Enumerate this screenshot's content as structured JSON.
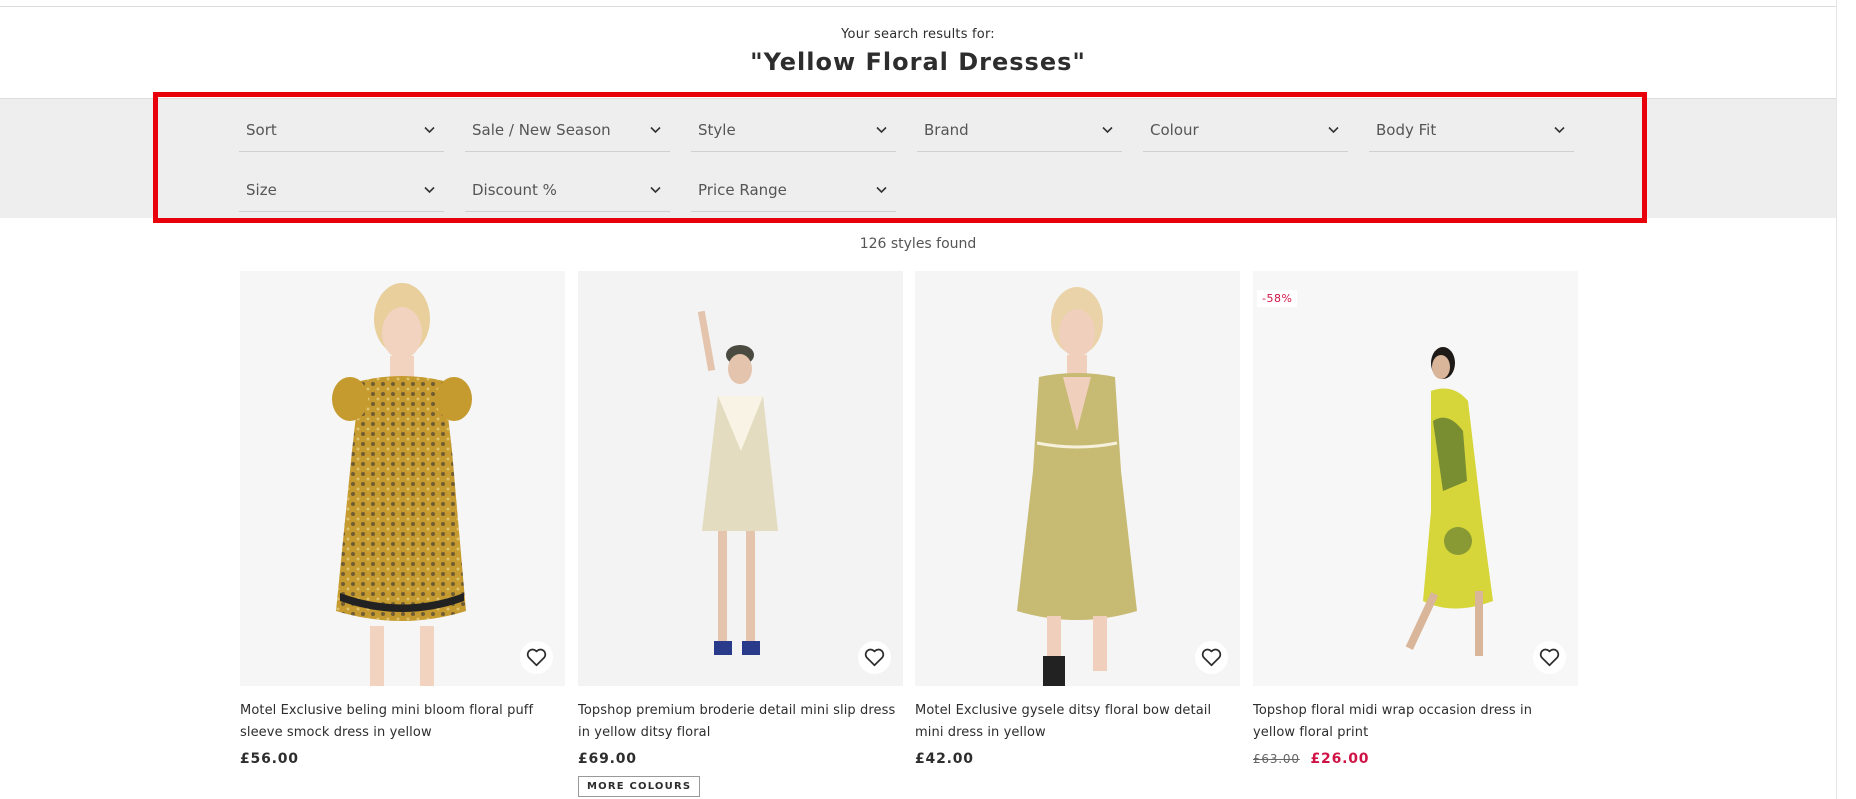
{
  "search": {
    "intro": "Your search results for:",
    "term": "\"Yellow Floral Dresses\""
  },
  "filters": [
    {
      "label": "Sort"
    },
    {
      "label": "Sale / New Season"
    },
    {
      "label": "Style"
    },
    {
      "label": "Brand"
    },
    {
      "label": "Colour"
    },
    {
      "label": "Body Fit"
    },
    {
      "label": "Size"
    },
    {
      "label": "Discount %"
    },
    {
      "label": "Price Range"
    }
  ],
  "results": {
    "count_text": "126 styles found"
  },
  "products": [
    {
      "title": "Motel Exclusive beling mini bloom floral puff sleeve smock dress in yellow",
      "price": "£56.00"
    },
    {
      "title": "Topshop premium broderie detail mini slip dress in yellow ditsy floral",
      "price": "£69.00",
      "more_colours": "MORE COLOURS"
    },
    {
      "title": "Motel Exclusive gysele ditsy floral bow detail mini dress in yellow",
      "price": "£42.00"
    },
    {
      "title": "Topshop floral midi wrap occasion dress in yellow floral print",
      "badge": "-58%",
      "original_price": "£63.00",
      "sale_price": "£26.00"
    }
  ],
  "colors": {
    "highlight": "#e8000b",
    "sale": "#d01345",
    "filter_band": "#eeeeee"
  }
}
